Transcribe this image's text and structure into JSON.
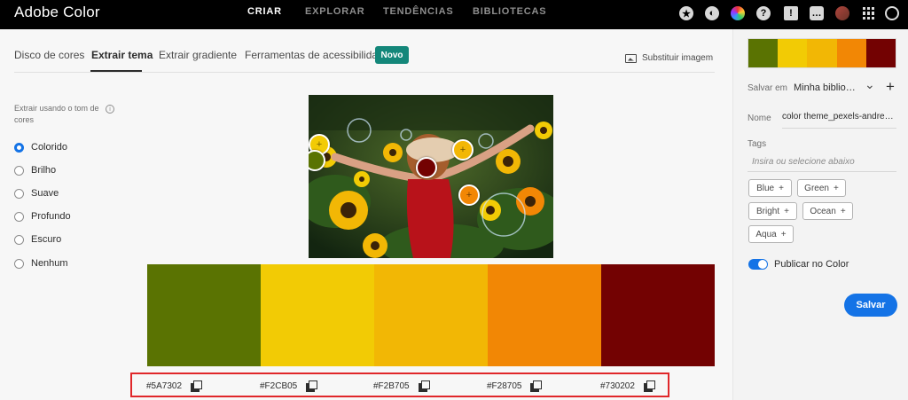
{
  "app": {
    "title": "Adobe Color"
  },
  "topnav": [
    {
      "label": "CRIAR",
      "active": true
    },
    {
      "label": "EXPLORAR",
      "active": false
    },
    {
      "label": "TENDÊNCIAS",
      "active": false
    },
    {
      "label": "BIBLIOTECAS",
      "active": false
    }
  ],
  "toolbar_icons": [
    "star-icon",
    "moon-icon",
    "color-wheel-icon",
    "help-icon",
    "feedback-icon",
    "chat-icon",
    "avatar",
    "apps-grid-icon",
    "creative-cloud-icon"
  ],
  "toolbar_glyphs": {
    "star": "★",
    "moon": "◐",
    "help": "?",
    "feedback": "!",
    "chat": "…"
  },
  "tabs": [
    {
      "label": "Disco de cores",
      "active": false
    },
    {
      "label": "Extrair tema",
      "active": true
    },
    {
      "label": "Extrair gradiente",
      "active": false
    },
    {
      "label": "Ferramentas de acessibilidade",
      "active": false
    }
  ],
  "badge": {
    "label": "Novo"
  },
  "replace_image": {
    "label": "Substituir imagem"
  },
  "mood": {
    "label": "Extrair usando o tom de cores",
    "info_glyph": "i",
    "options": [
      {
        "label": "Colorido",
        "selected": true
      },
      {
        "label": "Brilho",
        "selected": false
      },
      {
        "label": "Suave",
        "selected": false
      },
      {
        "label": "Profundo",
        "selected": false
      },
      {
        "label": "Escuro",
        "selected": false
      },
      {
        "label": "Nenhum",
        "selected": false
      }
    ]
  },
  "marker_glyph": "+",
  "theme": [
    {
      "hex": "#5A7302",
      "color": "#5A7302"
    },
    {
      "hex": "#F2CB05",
      "color": "#F2CB05"
    },
    {
      "hex": "#F2B705",
      "color": "#F2B705"
    },
    {
      "hex": "#F28705",
      "color": "#F28705"
    },
    {
      "hex": "#730202",
      "color": "#730202"
    }
  ],
  "sidebar": {
    "save_in_label": "Salvar em",
    "library_value": "Minha biblioteca",
    "chevron_glyph": "⌄",
    "plus_glyph": "+",
    "name_label": "Nome",
    "name_value": "color theme_pexels-andrea-piacquadio",
    "tags_label": "Tags",
    "tags_placeholder": "Insira ou selecione abaixo",
    "tags": [
      {
        "label": "Blue"
      },
      {
        "label": "Green"
      },
      {
        "label": "Bright"
      },
      {
        "label": "Ocean"
      },
      {
        "label": "Aqua"
      }
    ],
    "publish_label": "Publicar no Color",
    "publish_on": true,
    "save_label": "Salvar"
  }
}
